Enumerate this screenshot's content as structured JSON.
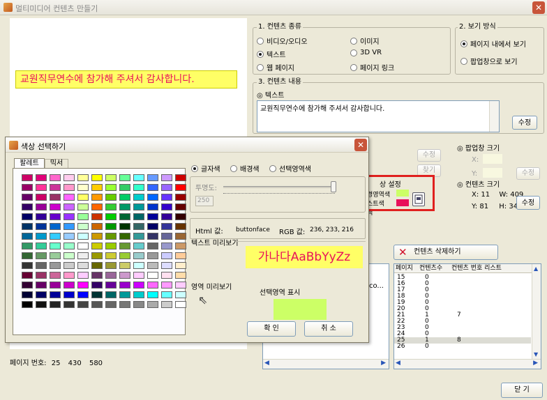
{
  "window": {
    "title": "멀티미디어 컨텐츠 만들기",
    "close_glyph": "✕"
  },
  "preview": {
    "banner_text": "교원직무연수에 참가해 주셔서 감사합니다."
  },
  "content_type": {
    "legend": "1. 컨텐츠 종류",
    "options": [
      "비디오/오디오",
      "이미지",
      "텍스트",
      "3D VR",
      "웹 페이지",
      "페이지 링크"
    ],
    "selected": "텍스트"
  },
  "view_mode": {
    "legend": "2. 보기 방식",
    "options": [
      "페이지 내에서 보기",
      "팝업창으로 보기"
    ],
    "selected": "페이지 내에서 보기"
  },
  "content_body": {
    "legend": "3. 컨텐츠 내용",
    "heading": "◎ 텍스트",
    "text": "교원직무연수에 참가해 주셔서 감사합니다.",
    "edit_button": "수정"
  },
  "popup_size": {
    "heading": "◎ 팝업창 크기",
    "x_label": "X:",
    "y_label": "Y:",
    "edit_button": "수정"
  },
  "left_buttons": {
    "edit": "수정",
    "browse": "찾기"
  },
  "color_settings": {
    "heading": "상 설정",
    "row1": "경영역색",
    "row2": "스트색",
    "row3": "색",
    "color1": "#ccff66",
    "color2": "#e8115a"
  },
  "content_size": {
    "heading": "◎ 컨텐츠 크기",
    "x_label": "X:",
    "x": "11",
    "w_label": "W:",
    "w": "409",
    "y_label": "Y:",
    "y": "81",
    "h_label": "H:",
    "h": "34",
    "edit_button": "수정"
  },
  "delete_button": "컨텐츠 삭제하기",
  "url_fragment": "l,co...",
  "page_list": {
    "columns": [
      "페이지",
      "컨텐츠수",
      "컨텐츠 번호 리스트"
    ],
    "rows": [
      [
        "15",
        "0",
        ""
      ],
      [
        "16",
        "0",
        ""
      ],
      [
        "17",
        "0",
        ""
      ],
      [
        "18",
        "0",
        ""
      ],
      [
        "19",
        "0",
        ""
      ],
      [
        "20",
        "0",
        ""
      ],
      [
        "21",
        "1",
        "7"
      ],
      [
        "22",
        "0",
        ""
      ],
      [
        "23",
        "0",
        ""
      ],
      [
        "24",
        "0",
        ""
      ],
      [
        "25",
        "1",
        "8"
      ],
      [
        "26",
        "0",
        ""
      ]
    ],
    "selected_page": "25"
  },
  "page_info": {
    "label": "페이지 번호:",
    "page": "25",
    "width": "430",
    "height": "580"
  },
  "close_button": "닫 기",
  "color_dialog": {
    "title": "색상 선택하기",
    "tabs": [
      "팔레트",
      "믹서"
    ],
    "targets": [
      "글자색",
      "배경색",
      "선택영역색"
    ],
    "selected_target": "글자색",
    "opacity_label": "투명도:",
    "opacity_value": "250",
    "opacity_level": 1.0,
    "html_label": "Html 값:",
    "html_value": "buttonface",
    "rgb_label": "RGB 값:",
    "rgb_value": "236, 233, 216",
    "text_preview_label": "텍스트 미리보기",
    "text_preview_sample": "가나다AaBbYyZz",
    "area_preview_label": "영역 미리보기",
    "area_preview_caption": "선택영역 표시",
    "ok_button": "확 인",
    "cancel_button": "취 소",
    "text_preview_fg": "#e8115a",
    "text_preview_bg": "#ffff66",
    "area_preview_bg": "#ccff66",
    "palette": [
      [
        "#cc0066",
        "#e0007a",
        "#ff66cc",
        "#ffccee",
        "#ffff99",
        "#ffff00",
        "#ccff66",
        "#66ff99",
        "#66ffff",
        "#6699ff",
        "#cc99ff",
        "#cc0000"
      ],
      [
        "#990066",
        "#ff3399",
        "#cc3399",
        "#ff99cc",
        "#ffffcc",
        "#ffcc00",
        "#99ff33",
        "#33cc66",
        "#33ffcc",
        "#3366ff",
        "#9966ff",
        "#ff0000"
      ],
      [
        "#660066",
        "#cc0066",
        "#993366",
        "#ff66ff",
        "#ffff66",
        "#ff9900",
        "#66cc00",
        "#00cc66",
        "#00cccc",
        "#0066ff",
        "#6633ff",
        "#990000"
      ],
      [
        "#330066",
        "#990099",
        "#cc00cc",
        "#cc66ff",
        "#ccff99",
        "#ff6600",
        "#33cc33",
        "#009966",
        "#009999",
        "#0033cc",
        "#3300cc",
        "#660000"
      ],
      [
        "#000066",
        "#330099",
        "#6600cc",
        "#9933ff",
        "#99ff99",
        "#cc3300",
        "#00cc00",
        "#006633",
        "#006666",
        "#000099",
        "#330099",
        "#330000"
      ],
      [
        "#003366",
        "#003399",
        "#0066cc",
        "#3399ff",
        "#ccffcc",
        "#cc6600",
        "#009900",
        "#003300",
        "#336666",
        "#000066",
        "#333399",
        "#663300"
      ],
      [
        "#006699",
        "#0099cc",
        "#33ccff",
        "#99ccff",
        "#ccffff",
        "#cc9900",
        "#669900",
        "#336600",
        "#339999",
        "#333366",
        "#666699",
        "#996633"
      ],
      [
        "#339966",
        "#33cc99",
        "#66ffcc",
        "#99ffcc",
        "#ffffff",
        "#cccc00",
        "#99cc00",
        "#669933",
        "#66cccc",
        "#666666",
        "#9999cc",
        "#cc9966"
      ],
      [
        "#336633",
        "#669966",
        "#99cc99",
        "#ccffcc",
        "#eeeeee",
        "#999900",
        "#cccc33",
        "#99cc33",
        "#99cccc",
        "#999999",
        "#ccccff",
        "#ffcc99"
      ],
      [
        "#333333",
        "#666666",
        "#999999",
        "#cccccc",
        "#dddddd",
        "#666600",
        "#999933",
        "#cccc66",
        "#ccffff",
        "#bbbbbb",
        "#ddddff",
        "#ffeecc"
      ],
      [
        "#660033",
        "#993366",
        "#cc6699",
        "#ff99cc",
        "#ffccff",
        "#663366",
        "#996699",
        "#cc99cc",
        "#ffccff",
        "#ffffff",
        "#ffe0f0",
        "#ffddaa"
      ],
      [
        "#330033",
        "#660066",
        "#990099",
        "#cc00cc",
        "#ff00ff",
        "#330066",
        "#660099",
        "#9900cc",
        "#cc00ff",
        "#ff66ff",
        "#ff99ff",
        "#ffccff"
      ],
      [
        "#000033",
        "#000066",
        "#000099",
        "#0000cc",
        "#0000ff",
        "#003333",
        "#006666",
        "#009999",
        "#00cccc",
        "#00ffff",
        "#66ffff",
        "#ccffff"
      ],
      [
        "#000000",
        "#111111",
        "#222222",
        "#333333",
        "#444444",
        "#555555",
        "#666666",
        "#777777",
        "#888888",
        "#aaaaaa",
        "#cccccc",
        "#ffffff"
      ]
    ]
  }
}
